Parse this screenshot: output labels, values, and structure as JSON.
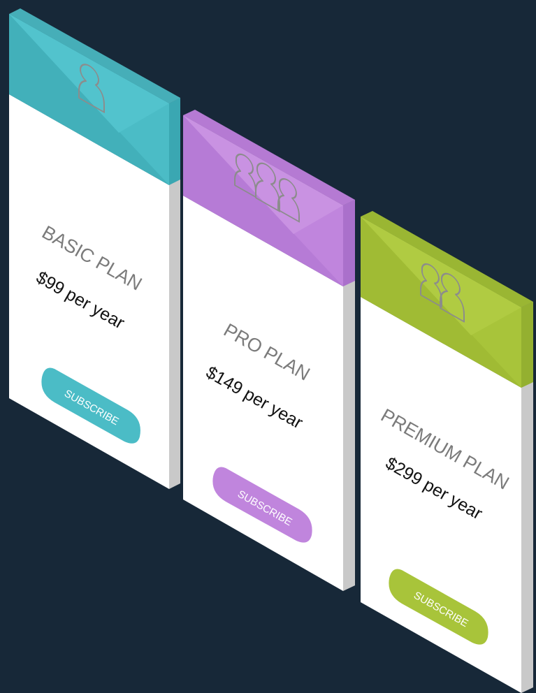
{
  "plans": [
    {
      "title": "BASIC PLAN",
      "price": "$99 per year",
      "button_label": "SUBSCRIBE",
      "icon": "single-user-icon",
      "accent": "#4bbcc6",
      "accent_dark": "#3aa7b2",
      "accent_side": "#2f96a0"
    },
    {
      "title": "PRO PLAN",
      "price": "$149 per year",
      "button_label": "SUBSCRIBE",
      "icon": "three-users-icon",
      "accent": "#c085dd",
      "accent_dark": "#aa70cb",
      "accent_side": "#9460b5"
    },
    {
      "title": "PREMIUM PLAN",
      "price": "$299 per year",
      "button_label": "SUBSCRIBE",
      "icon": "two-users-icon",
      "accent": "#a8c43a",
      "accent_dark": "#94b030",
      "accent_side": "#809a26"
    }
  ],
  "colors": {
    "background": "#172838",
    "card_face": "#ffffff",
    "card_side": "#c9c9c9"
  }
}
